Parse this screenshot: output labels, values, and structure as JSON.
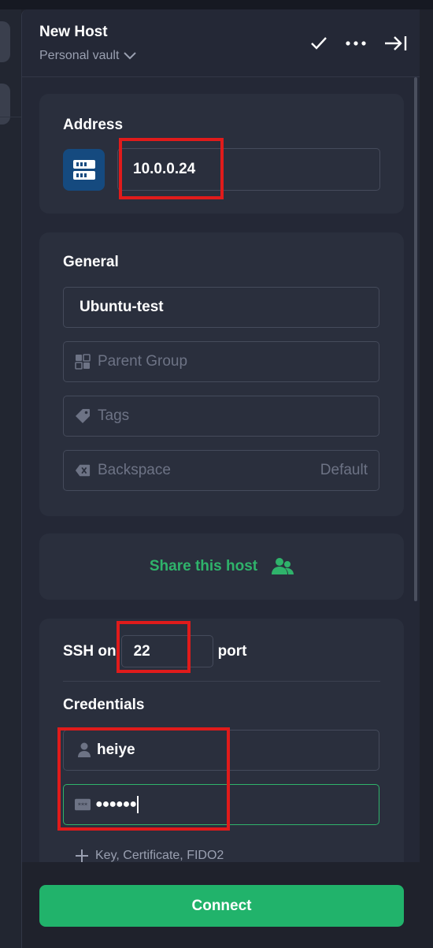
{
  "header": {
    "title": "New Host",
    "vault": "Personal vault"
  },
  "address": {
    "label": "Address",
    "value": "10.0.0.24"
  },
  "general": {
    "label": "General",
    "name_value": "Ubuntu-test",
    "parent_group_placeholder": "Parent Group",
    "tags_placeholder": "Tags",
    "backspace_label": "Backspace",
    "backspace_value": "Default"
  },
  "share": {
    "label": "Share this host"
  },
  "ssh": {
    "prefix": "SSH on",
    "port": "22",
    "suffix": "port",
    "credentials_label": "Credentials",
    "username": "heiye",
    "password_mask": "●●●●●●",
    "add_key_label": "Key, Certificate, FIDO2"
  },
  "footer": {
    "connect_label": "Connect"
  },
  "colors": {
    "accent": "#21b36b",
    "annotation": "#e01b1b",
    "server_icon_bg": "#154a7f"
  }
}
